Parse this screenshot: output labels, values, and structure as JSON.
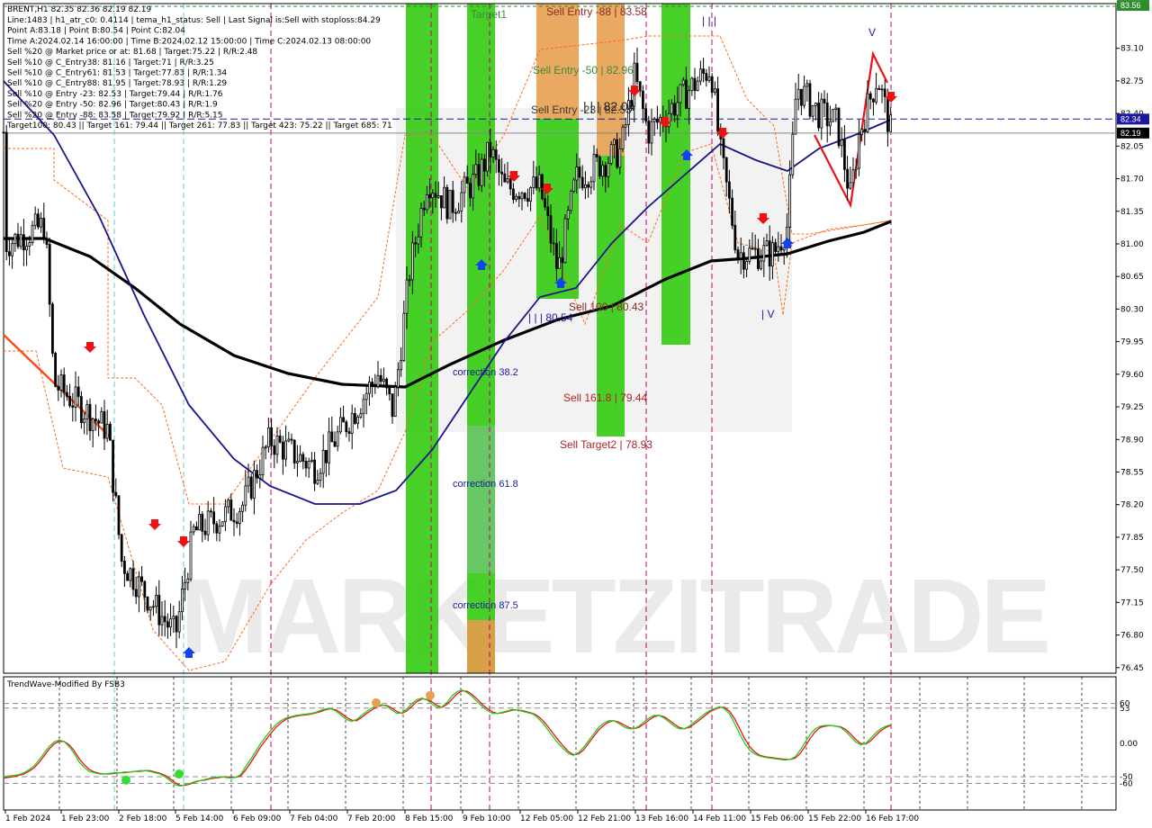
{
  "chart_data": {
    "type": "candlestick",
    "symbol_line": "BRENT,H1  82.35 82.36 82.19 82.19",
    "info_lines": [
      "Line:1483 | h1_atr_c0: 0.4114 | tema_h1_status: Sell | Last Signal is:Sell with stoploss:84.29",
      "Point A:83.18 | Point B:80.54 | Point C:82.04",
      "Time A:2024.02.14 16:00:00 | Time B:2024.02.12 15:00:00 | Time C:2024.02.13 08:00:00",
      "Sell %20 @ Market price or at: 81.68 | Target:75.22 | R/R:2.48",
      "Sell %10 @ C_Entry38: 81.16 | Target:71 | R/R:3.25",
      "Sell %10 @ C_Entry61: 81.53 | Target:77.83 | R/R:1.34",
      "Sell %10 @ C_Entry88: 81.95 | Target:78.93 | R/R:1.29",
      "Sell %10 @ Entry -23: 82.53 | Target:79.44 | R/R:1.76",
      "Sell %20 @ Entry -50: 82.96 | Target:80.43 | R/R:1.9",
      "Sell %20 @ Entry -88: 83.58 | Target:79.92 | R/R:5.15",
      "Target100: 80.43 || Target 161: 79.44 || Target 261: 77.83 || Target 423: 75.22 || Target 685: 71"
    ],
    "y_ticks": [
      "83.10",
      "82.75",
      "82.40",
      "82.05",
      "81.70",
      "81.35",
      "81.00",
      "80.65",
      "80.30",
      "79.95",
      "79.60",
      "79.25",
      "78.90",
      "78.55",
      "78.20",
      "77.85",
      "77.50",
      "77.15",
      "76.80",
      "76.45"
    ],
    "ylim": [
      76.39,
      83.58
    ],
    "price_labels": {
      "top": "83.56",
      "blue": "82.34",
      "current": "82.19"
    },
    "blue_line_value": 82.34,
    "current_price": 82.19,
    "x_labels": [
      "1 Feb 2024",
      "1 Feb 23:00",
      "2 Feb 18:00",
      "5 Feb 14:00",
      "6 Feb 09:00",
      "7 Feb 04:00",
      "7 Feb 20:00",
      "8 Feb 15:00",
      "9 Feb 10:00",
      "12 Feb 05:00",
      "12 Feb 21:00",
      "13 Feb 16:00",
      "14 Feb 11:00",
      "15 Feb 06:00",
      "15 Feb 22:00",
      "16 Feb 17:00"
    ],
    "annotations": [
      {
        "text": "Target1",
        "color": "#3a8a3a"
      },
      {
        "text": "Sell Entry -88 | 83.58",
        "color": "#8b2a2a"
      },
      {
        "text": "Sell Entry -50 | 82.96",
        "color": "#3a8a3a"
      },
      {
        "text": "Sell Entry -23 | 82.53",
        "color": "#3a3a3a"
      },
      {
        "text": "| | | 82.04",
        "color": "#222222"
      },
      {
        "text": "| | |",
        "color": "#1a1aa0"
      },
      {
        "text": "V",
        "color": "#1a1aa0"
      },
      {
        "text": "| | | 80.54",
        "color": "#1a1aa0"
      },
      {
        "text": "Sell 100 | 80.43",
        "color": "#8b2a2a"
      },
      {
        "text": "Sell 161.8 | 79.44",
        "color": "#b22222"
      },
      {
        "text": "Sell Target2 | 78.93",
        "color": "#b22222"
      },
      {
        "text": "correction 38.2",
        "color": "#1a1aa0"
      },
      {
        "text": "correction 61.8",
        "color": "#1a1aa0"
      },
      {
        "text": "correction 87.5",
        "color": "#1a1aa0"
      },
      {
        "text": "| V",
        "color": "#1a1aa0"
      }
    ],
    "watermark": "MARKETZITRADE",
    "oscillator": {
      "title": "TrendWave-Modified By FSB3",
      "y_ticks": [
        "60",
        "53",
        "0.00",
        "-50",
        "-60"
      ],
      "ylim": [
        -100,
        100
      ],
      "green_series": [
        -50,
        -49,
        -48,
        -47,
        -44,
        -40,
        -34,
        -25,
        -15,
        -5,
        2,
        5,
        3,
        -5,
        -15,
        -28,
        -36,
        -42,
        -44,
        -46,
        -46,
        -45,
        -44,
        -44,
        -43,
        -43,
        -42,
        -41,
        -41,
        -42,
        -44,
        -46,
        -50,
        -56,
        -62,
        -64,
        -62,
        -60,
        -57,
        -56,
        -54,
        -52,
        -51,
        -50,
        -51,
        -52,
        -51,
        -47,
        -35,
        -24,
        -12,
        0,
        10,
        20,
        28,
        34,
        38,
        40,
        42,
        43,
        44,
        45,
        47,
        50,
        52,
        52,
        48,
        42,
        36,
        33,
        36,
        42,
        48,
        53,
        57,
        58,
        56,
        50,
        45,
        46,
        52,
        60,
        66,
        68,
        65,
        59,
        54,
        55,
        62,
        72,
        78,
        80,
        76,
        70,
        62,
        55,
        49,
        45,
        45,
        47,
        49,
        51,
        50,
        48,
        46,
        44,
        38,
        30,
        20,
        10,
        0,
        -8,
        -15,
        -18,
        -14,
        -6,
        4,
        14,
        24,
        30,
        34,
        34,
        30,
        25,
        22,
        22,
        26,
        32,
        38,
        42,
        42,
        38,
        32,
        26,
        22,
        22,
        26,
        32,
        38,
        44,
        49,
        52,
        55,
        52,
        44,
        30,
        14,
        0,
        -10,
        -16,
        -19,
        -21,
        -22,
        -23,
        -24,
        -25,
        -24,
        -20,
        -10,
        2,
        14,
        22,
        26,
        27,
        27,
        26,
        24,
        18,
        10,
        2,
        -2,
        0,
        8,
        16,
        22,
        26,
        28
      ],
      "red_series": [
        -52,
        -51,
        -50,
        -48,
        -46,
        -42,
        -37,
        -29,
        -19,
        -9,
        -1,
        3,
        3,
        -2,
        -11,
        -23,
        -32,
        -39,
        -43,
        -45,
        -46,
        -46,
        -45,
        -44,
        -44,
        -43,
        -42,
        -42,
        -41,
        -41,
        -43,
        -45,
        -48,
        -53,
        -59,
        -63,
        -63,
        -61,
        -58,
        -56,
        -55,
        -53,
        -52,
        -51,
        -50,
        -51,
        -51,
        -49,
        -40,
        -29,
        -17,
        -5,
        5,
        15,
        24,
        31,
        36,
        39,
        41,
        42,
        43,
        44,
        46,
        48,
        51,
        52,
        50,
        45,
        39,
        35,
        34,
        39,
        45,
        50,
        55,
        57,
        57,
        53,
        48,
        45,
        49,
        56,
        63,
        67,
        66,
        62,
        57,
        54,
        59,
        67,
        75,
        79,
        78,
        73,
        66,
        58,
        52,
        47,
        45,
        46,
        48,
        50,
        50,
        49,
        47,
        45,
        41,
        34,
        25,
        15,
        5,
        -4,
        -12,
        -17,
        -16,
        -10,
        0,
        10,
        20,
        27,
        32,
        34,
        32,
        28,
        24,
        22,
        24,
        29,
        35,
        40,
        42,
        40,
        35,
        29,
        24,
        22,
        24,
        29,
        35,
        41,
        47,
        51,
        54,
        54,
        48,
        37,
        22,
        7,
        -5,
        -13,
        -18,
        -20,
        -21,
        -22,
        -23,
        -24,
        -24,
        -22,
        -15,
        -4,
        8,
        18,
        24,
        26,
        27,
        26,
        25,
        21,
        14,
        6,
        0,
        -1,
        4,
        12,
        19,
        24,
        27
      ]
    }
  }
}
